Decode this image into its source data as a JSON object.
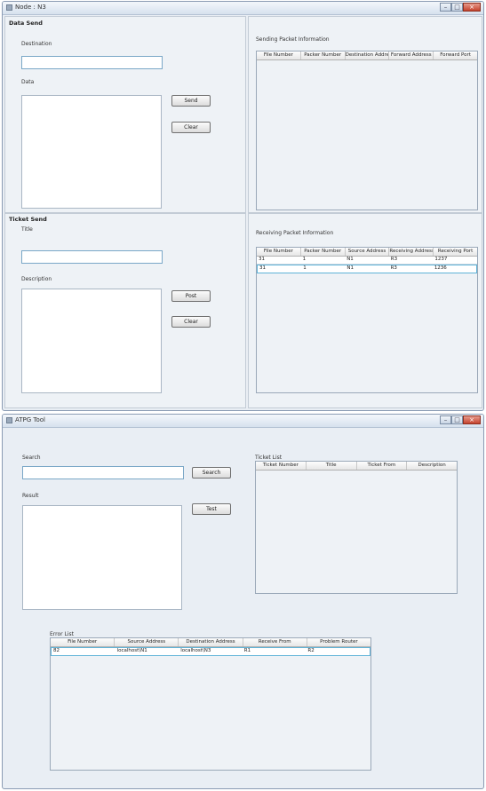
{
  "node_window": {
    "title": "Node : N3",
    "data_send": {
      "header": "Data Send",
      "destination_label": "Destination",
      "destination_value": "",
      "data_label": "Data",
      "send_label": "Send",
      "clear_label": "Clear"
    },
    "ticket_send": {
      "header": "Ticket Send",
      "title_label": "Title",
      "title_value": "",
      "description_label": "Description",
      "post_label": "Post",
      "clear_label": "Clear"
    },
    "sending": {
      "label": "Sending Packet Information",
      "columns": [
        "File Number",
        "Packer Number",
        "Destination Address",
        "Forward Address",
        "Forward Port"
      ],
      "rows": []
    },
    "receiving": {
      "label": "Receiving Packet Information",
      "columns": [
        "File Number",
        "Packer Number",
        "Source Address",
        "Receiving Address",
        "Receiving Port"
      ],
      "rows": [
        [
          "31",
          "1",
          "N1",
          "R3",
          "1237"
        ],
        [
          "31",
          "1",
          "N1",
          "R3",
          "1236"
        ]
      ]
    }
  },
  "atpg_window": {
    "title": "ATPG Tool",
    "search_label": "Search",
    "search_value": "",
    "search_button": "Search",
    "result_label": "Result",
    "test_button": "Test",
    "ticket_list": {
      "label": "Ticket List",
      "columns": [
        "Ticket Number",
        "Title",
        "Ticket From",
        "Description"
      ],
      "rows": []
    },
    "error_list": {
      "label": "Error List",
      "columns": [
        "File Number",
        "Source Address",
        "Destination Address",
        "Receive From",
        "Problem Router"
      ],
      "rows": [
        [
          "82",
          "localhost\\N1",
          "localhost\\N3",
          "R1",
          "R2"
        ]
      ]
    }
  }
}
